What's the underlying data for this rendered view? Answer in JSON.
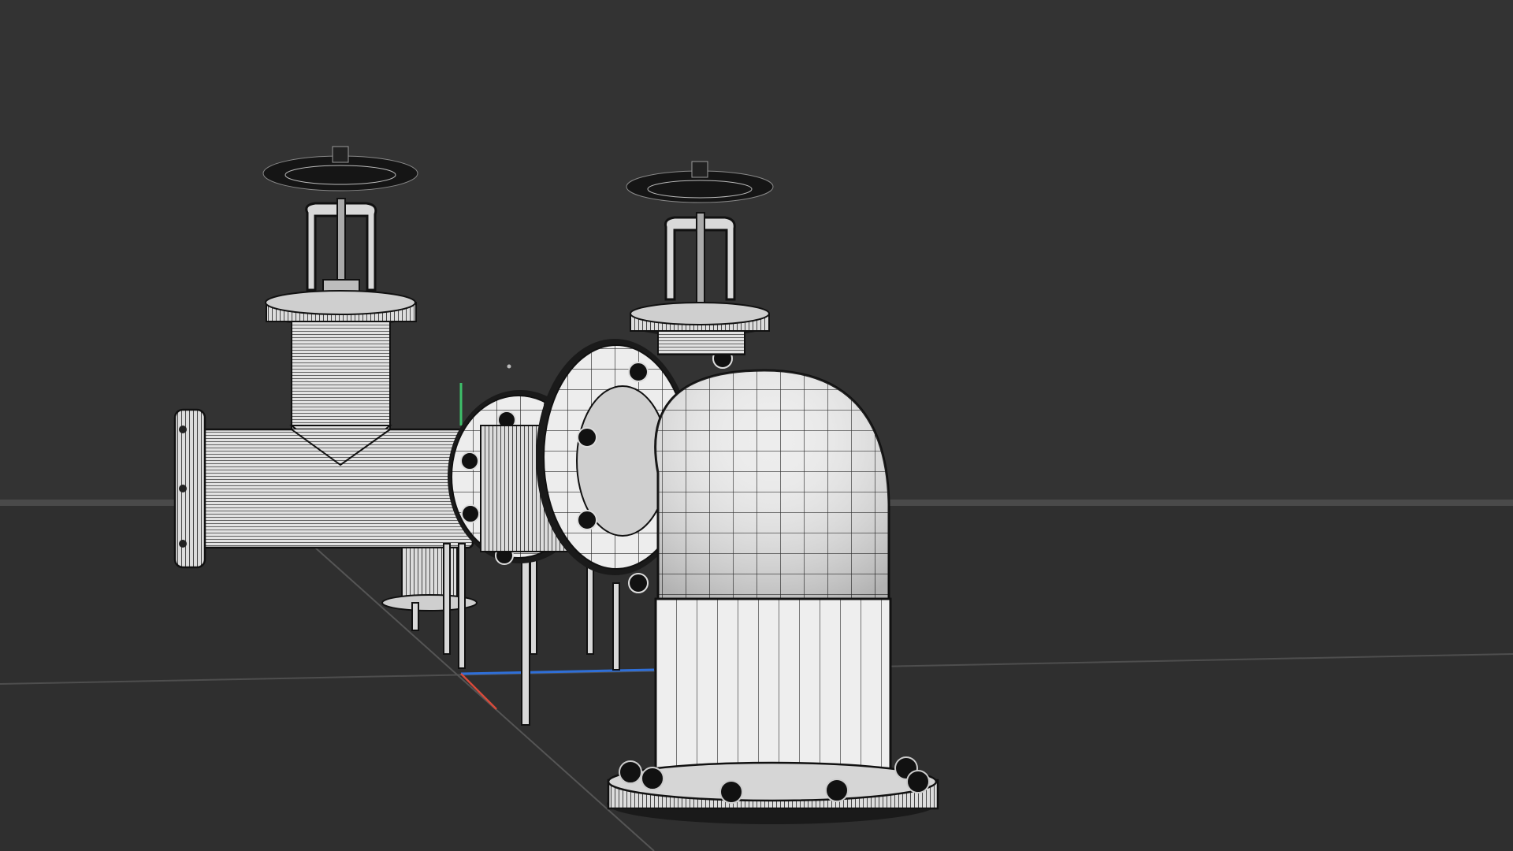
{
  "app": {
    "title": ""
  },
  "viewport": {
    "background": "#333333",
    "floor_color": "#2d2d2d",
    "horizon_color": "#4a4a4a",
    "gizmo": {
      "x_axis_color": "#d84a3a",
      "y_axis_color": "#3ec06a",
      "z_axis_color": "#2f6fd8"
    }
  },
  "model": {
    "display_mode": "wireframe-shaded",
    "base_color": "#e6e6e6",
    "wire_color": "#1a1a1a",
    "parts": [
      {
        "name": "valve-left",
        "icon": "gate-valve-icon"
      },
      {
        "name": "valve-right",
        "icon": "gate-valve-icon"
      },
      {
        "name": "horizontal-pipe",
        "icon": "pipe-icon"
      },
      {
        "name": "elbow-pipe",
        "icon": "elbow-icon"
      },
      {
        "name": "flanges",
        "icon": "flange-icon"
      },
      {
        "name": "support-legs",
        "icon": "support-icon"
      }
    ]
  }
}
